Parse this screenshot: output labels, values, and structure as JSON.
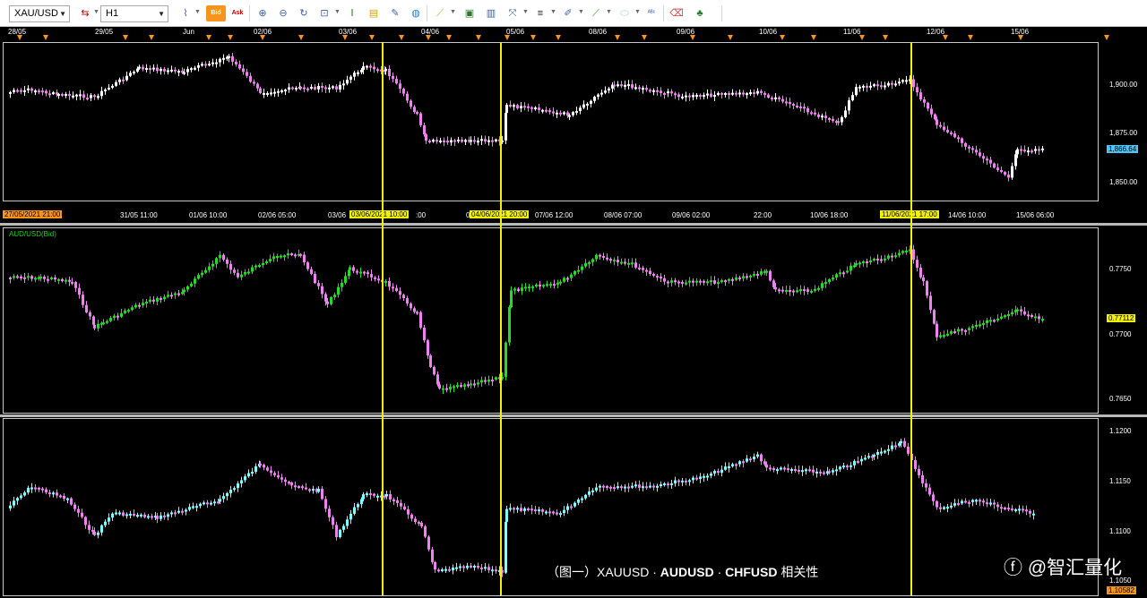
{
  "toolbar": {
    "symbol": "XAU/USD",
    "timeframe": "H1",
    "bid_label": "Bid",
    "ask_label": "Ask",
    "icons": [
      "chart-type-icon",
      "bid-icon",
      "ask-icon",
      "zoom-in-icon",
      "zoom-out-icon",
      "refresh-icon",
      "zoom-fit-icon",
      "indicator-icon",
      "note-icon",
      "draw-icon",
      "globe-icon",
      "ruler-icon",
      "image-icon",
      "print-icon",
      "fibonacci-icon",
      "lines-icon",
      "trend-pen-icon",
      "line-tool-icon",
      "ellipse-icon",
      "text-abc-icon",
      "eraser-icon",
      "tree-icon"
    ]
  },
  "top_timeline": {
    "labels": [
      "28/05",
      "29/05",
      "Jun",
      "02/06",
      "03/06",
      "04/06",
      "05/06",
      "08/06",
      "09/06",
      "10/06",
      "11/06",
      "12/06",
      "15/06"
    ]
  },
  "bottom_timeline": {
    "labels": [
      "31/05 11:00",
      "01/06 10:00",
      "02/06 05:00",
      "03/06",
      "07/06 12:00",
      "08/06 07:00",
      "09/06 02:00",
      "22:00",
      "10/06 18:00",
      "14/06 10:00",
      "15/06 06:00"
    ],
    "start_tag": "27/05/2021 21:00",
    "cursor_tags": [
      "03/06/2021 10:00",
      "04/06/2021 20:00",
      "11/06/2021 17:00"
    ],
    "cursor_tag_tails": [
      ":00",
      "0"
    ]
  },
  "panels": [
    {
      "id": "xauusd",
      "title": "",
      "price_labels": [
        "1,900.00",
        "1,875.00",
        "1,850.00"
      ],
      "current_price": "1,866.64",
      "current_tag_color": "#4fc3f7"
    },
    {
      "id": "audusd",
      "title": "AUD/USD(Bid)",
      "price_labels": [
        "0.7750",
        "0.7700",
        "0.7650"
      ],
      "current_price": "0.77112",
      "current_tag_color": "#f2f200"
    },
    {
      "id": "chfusd",
      "title": "",
      "price_labels": [
        "1.1200",
        "1.1150",
        "1.1100",
        "1.1050"
      ],
      "current_price": "1.10582",
      "current_tag_color": "#f7941d"
    }
  ],
  "colors": {
    "background": "#000000",
    "cursor_line": "#f2f200",
    "bull_candle_xau": "#ffffff",
    "bear_candle": "#ee82ee",
    "bull_candle_aud": "#22dd22",
    "bull_candle_chf": "#7fffff",
    "accent_orange": "#f7941d"
  },
  "caption": {
    "prefix": "（图一）XAUUSD · ",
    "bold1": "AUDUSD",
    "mid": " · ",
    "bold2": "CHFUSD",
    "suffix": " 相关性"
  },
  "watermark": "ⓕ @智汇量化"
}
